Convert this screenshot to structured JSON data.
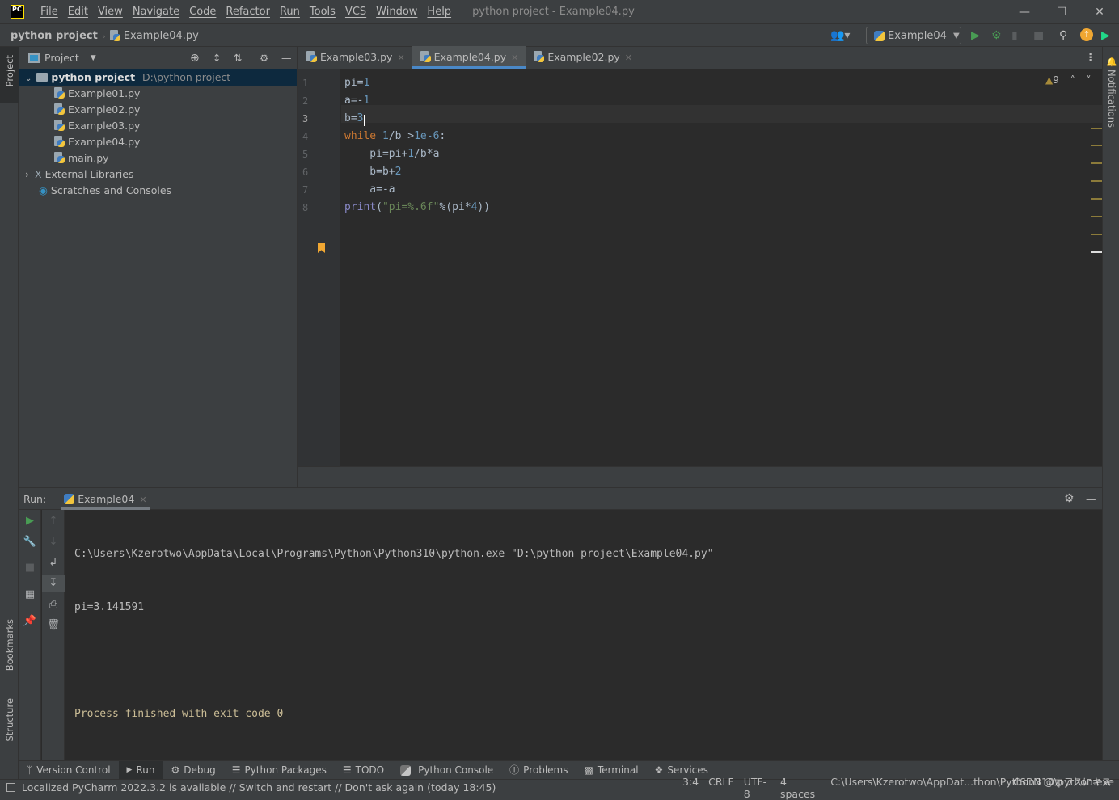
{
  "titlebar": {
    "logo": "PC",
    "menu": [
      "File",
      "Edit",
      "View",
      "Navigate",
      "Code",
      "Refactor",
      "Run",
      "Tools",
      "VCS",
      "Window",
      "Help"
    ],
    "title": "python project - Example04.py"
  },
  "navbar": {
    "project": "python project",
    "file": "Example04.py",
    "run_config": "Example04"
  },
  "left_stripe": {
    "project": "Project",
    "bookmarks": "Bookmarks",
    "structure": "Structure"
  },
  "right_stripe": {
    "notifications": "Notifications"
  },
  "project_panel": {
    "title": "Project",
    "root": "python project",
    "root_path": "D:\\python project",
    "files": [
      "Example01.py",
      "Example02.py",
      "Example03.py",
      "Example04.py",
      "main.py"
    ],
    "external": "External Libraries",
    "scratches": "Scratches and Consoles"
  },
  "editor": {
    "tabs": [
      {
        "label": "Example03.py"
      },
      {
        "label": "Example04.py",
        "active": true
      },
      {
        "label": "Example02.py"
      }
    ],
    "warnings": "9",
    "lines": [
      [
        [
          "t-op",
          "pi=",
          "1"
        ],
        [
          "t-num",
          "1"
        ]
      ],
      [
        [
          "t-op",
          "a=-"
        ],
        [
          "t-num",
          "1"
        ]
      ],
      [
        [
          "t-op",
          "b="
        ],
        [
          "t-num",
          "3"
        ]
      ],
      [
        [
          "t-kw",
          "while "
        ],
        [
          "t-num",
          "1"
        ],
        [
          "t-op",
          "/b >"
        ],
        [
          "t-num",
          "1e-6"
        ],
        [
          "t-op",
          ":"
        ]
      ],
      [
        [
          "t-op",
          "    pi=pi+"
        ],
        [
          "t-num",
          "1"
        ],
        [
          "t-op",
          "/b*a"
        ]
      ],
      [
        [
          "t-op",
          "    b=b+"
        ],
        [
          "t-num",
          "2"
        ]
      ],
      [
        [
          "t-op",
          "    a=-a"
        ]
      ],
      [
        [
          "t-fn",
          "print"
        ],
        [
          "t-op",
          "("
        ],
        [
          "t-str",
          "\"pi=%.6f\""
        ],
        [
          "t-op",
          "%(pi*"
        ],
        [
          "t-num",
          "4"
        ],
        [
          "t-op",
          "))"
        ]
      ]
    ]
  },
  "run": {
    "label": "Run:",
    "tab": "Example04",
    "output": [
      "C:\\Users\\Kzerotwo\\AppData\\Local\\Programs\\Python\\Python310\\python.exe \"D:\\python project\\Example04.py\"",
      "pi=3.141591",
      "",
      "Process finished with exit code 0"
    ]
  },
  "tool_tabs": [
    "Version Control",
    "Run",
    "Debug",
    "Python Packages",
    "TODO",
    "Python Console",
    "Problems",
    "Terminal",
    "Services"
  ],
  "status": {
    "message": "Localized PyCharm 2022.3.2 is available // Switch and restart // Don't ask again (today 18:45)",
    "position": "3:4",
    "line_sep": "CRLF",
    "encoding": "UTF-8",
    "indent": "4 spaces",
    "interpreter": "C:\\Users\\Kzerotwo\\AppDat...thon\\Python310\\python.exe",
    "watermark": "CSDN @カラスにキス"
  },
  "colors": {
    "editor_bg": "#2b2b2b",
    "panel_bg": "#3c3f41",
    "keyword": "#cc7832",
    "number": "#6897bb",
    "string": "#6a8759",
    "accent": "#4a88c7"
  }
}
